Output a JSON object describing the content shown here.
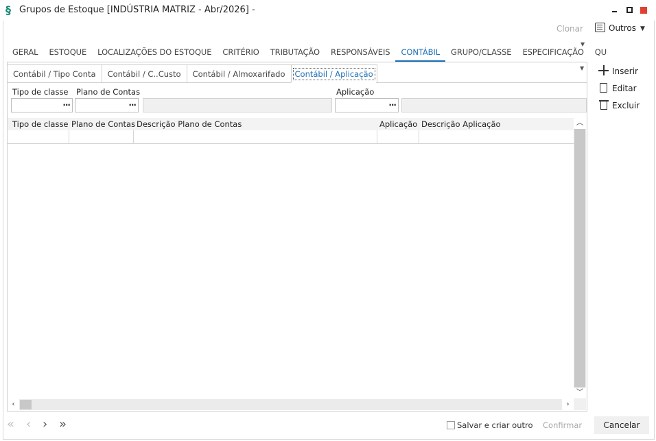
{
  "window": {
    "title": "Grupos de Estoque [INDÚSTRIA MATRIZ - Abr/2026]  -"
  },
  "toolbar": {
    "clonar": "Clonar",
    "outros": "Outros"
  },
  "main_tabs": [
    {
      "label": "GERAL"
    },
    {
      "label": "ESTOQUE"
    },
    {
      "label": "LOCALIZAÇÕES DO ESTOQUE"
    },
    {
      "label": "CRITÉRIO"
    },
    {
      "label": "TRIBUTAÇÃO"
    },
    {
      "label": "RESPONSÁVEIS"
    },
    {
      "label": "CONTÁBIL",
      "active": true
    },
    {
      "label": "GRUPO/CLASSE"
    },
    {
      "label": "ESPECIFICAÇÃO"
    },
    {
      "label": "QU"
    }
  ],
  "sub_tabs": [
    {
      "label": "Contábil / Tipo Conta"
    },
    {
      "label": "Contábil / C..Custo"
    },
    {
      "label": "Contábil / Almoxarifado"
    },
    {
      "label": "Contábil / Aplicação",
      "active": true
    }
  ],
  "filters": {
    "tipo_classe_label": "Tipo de classe",
    "plano_contas_label": "Plano de Contas",
    "aplicacao_label": "Aplicação",
    "tipo_classe_value": "",
    "plano_contas_value": "",
    "plano_desc_value": "",
    "aplicacao_value": "",
    "aplicacao_desc_value": ""
  },
  "grid": {
    "columns": [
      "Tipo de classe",
      "Plano de Contas",
      "Descrição Plano de Contas",
      "Aplicação",
      "Descrição Aplicação"
    ],
    "rows": []
  },
  "side_actions": {
    "inserir": "Inserir",
    "editar": "Editar",
    "excluir": "Excluir"
  },
  "footer": {
    "salvar_criar_outro": "Salvar e criar outro",
    "confirmar": "Confirmar",
    "cancelar": "Cancelar"
  },
  "colors": {
    "accent": "#1b6fb5",
    "app_icon": "#1a8a7a",
    "close_button": "#e04030"
  }
}
